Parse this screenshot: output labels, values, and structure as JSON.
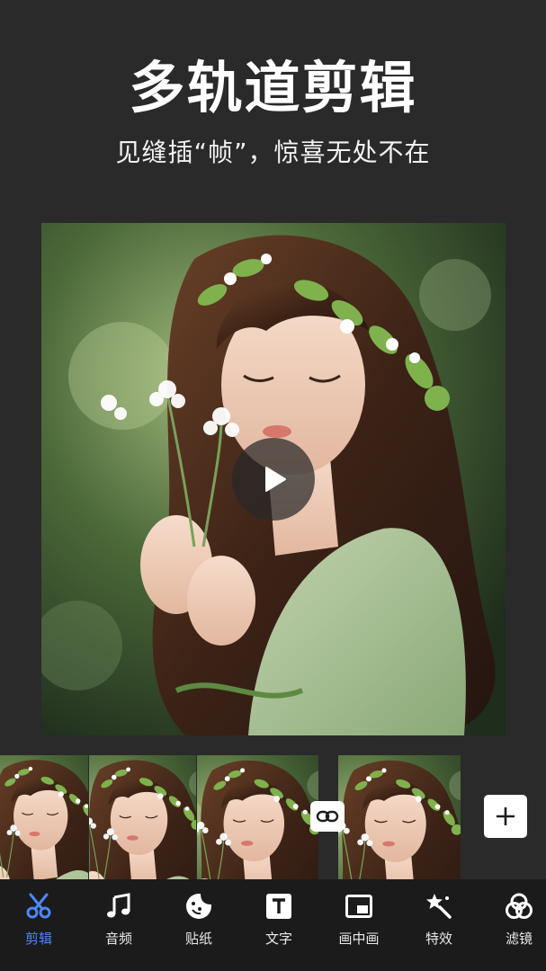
{
  "banner": {
    "title": "多轨道剪辑",
    "subtitle": "见缝插“帧”，惊喜无处不在"
  },
  "toolbar": {
    "items": [
      {
        "label": "剪辑",
        "icon": "scissors-icon",
        "active": true
      },
      {
        "label": "音频",
        "icon": "music-note-icon",
        "active": false
      },
      {
        "label": "贴纸",
        "icon": "sticker-icon",
        "active": false
      },
      {
        "label": "文字",
        "icon": "text-icon",
        "active": false
      },
      {
        "label": "画中画",
        "icon": "picture-in-picture-icon",
        "active": false
      },
      {
        "label": "特效",
        "icon": "magic-wand-icon",
        "active": false
      },
      {
        "label": "滤镜",
        "icon": "filter-circles-icon",
        "active": false
      }
    ]
  },
  "colors": {
    "background": "#2a2a2b",
    "toolbar_background": "#1b1b1c",
    "active_accent": "#4d87f5"
  }
}
